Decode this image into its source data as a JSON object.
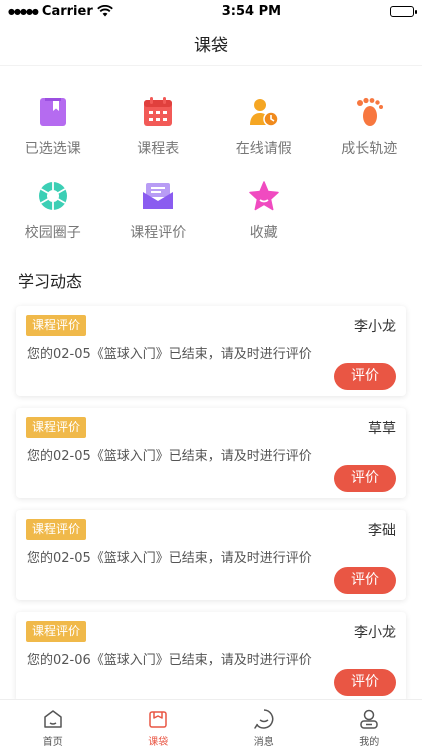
{
  "status_bar": {
    "carrier": "Carrier",
    "time": "3:54 PM"
  },
  "nav": {
    "title": "课袋"
  },
  "grid": [
    {
      "label": "已选选课",
      "icon": "selected-courses-icon",
      "color": "#b56bf0"
    },
    {
      "label": "课程表",
      "icon": "calendar-icon",
      "color": "#f25a57"
    },
    {
      "label": "在线请假",
      "icon": "leave-request-icon",
      "color": "#f5a623"
    },
    {
      "label": "成长轨迹",
      "icon": "footprint-icon",
      "color": "#f7773f"
    },
    {
      "label": "校园圈子",
      "icon": "shutter-icon",
      "color": "#3ccfb5"
    },
    {
      "label": "课程评价",
      "icon": "envelope-icon",
      "color": "#8a5cf0"
    },
    {
      "label": "收藏",
      "icon": "star-icon",
      "color": "#f04bc0"
    }
  ],
  "section": {
    "title": "学习动态"
  },
  "cards": [
    {
      "tag": "课程评价",
      "name": "李小龙",
      "message": "您的02-05《篮球入门》已结束，请及时进行评价",
      "button": "评价"
    },
    {
      "tag": "课程评价",
      "name": "草草",
      "message": "您的02-05《篮球入门》已结束，请及时进行评价",
      "button": "评价"
    },
    {
      "tag": "课程评价",
      "name": "李础",
      "message": "您的02-05《篮球入门》已结束，请及时进行评价",
      "button": "评价"
    },
    {
      "tag": "课程评价",
      "name": "李小龙",
      "message": "您的02-06《篮球入门》已结束，请及时进行评价",
      "button": "评价"
    }
  ],
  "tabs": [
    {
      "label": "首页",
      "icon": "home-icon",
      "active": false
    },
    {
      "label": "课袋",
      "icon": "bag-icon",
      "active": true
    },
    {
      "label": "消息",
      "icon": "message-icon",
      "active": false
    },
    {
      "label": "我的",
      "icon": "profile-icon",
      "active": false
    }
  ],
  "colors": {
    "accent": "#e95644",
    "tag": "#f0b94a"
  }
}
